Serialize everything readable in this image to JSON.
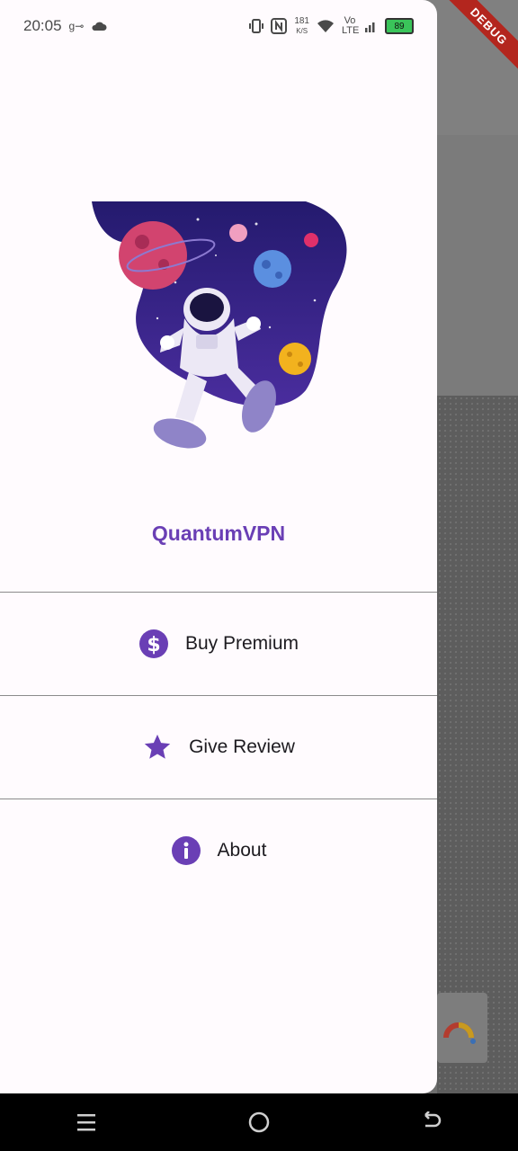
{
  "status_bar": {
    "time": "20:05",
    "speed_value": "181",
    "speed_unit": "K/S",
    "network": "Vo LTE",
    "battery": "89"
  },
  "debug_banner": "DEBUG",
  "drawer": {
    "app_name": "QuantumVPN",
    "menu": [
      {
        "label": "Buy Premium",
        "icon": "dollar-circle-icon"
      },
      {
        "label": "Give Review",
        "icon": "star-icon"
      },
      {
        "label": "About",
        "icon": "info-icon"
      }
    ]
  },
  "colors": {
    "accent": "#6a3fb5",
    "drawer_bg": "#fffbfe",
    "scrim": "#6e6e6e"
  }
}
